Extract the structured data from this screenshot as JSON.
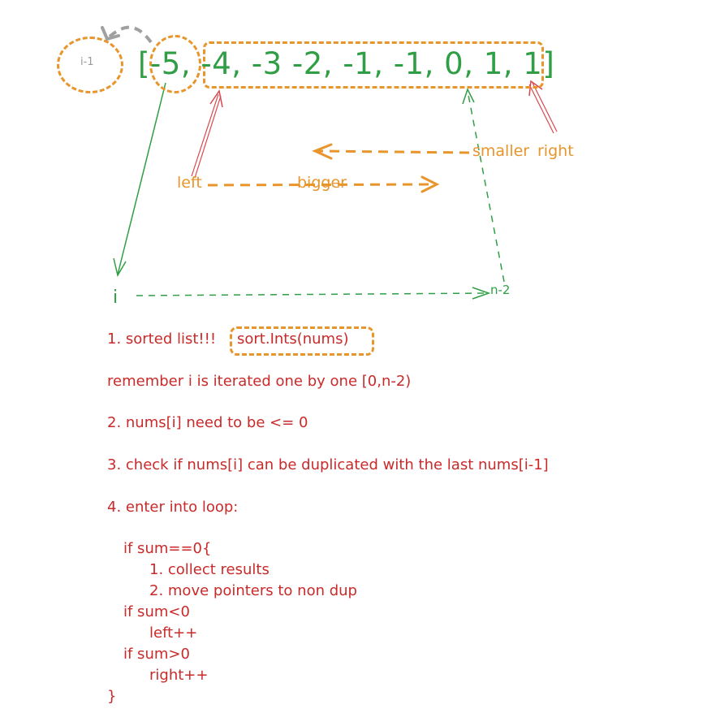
{
  "diagram": {
    "array_text": "[-5, -4, -3 -2, -1, -1, 0, 1, 1]",
    "prev_label": "i-1",
    "i_label": "i",
    "n2_label": "n-2",
    "left_label": "left",
    "bigger_label": "bigger",
    "smaller_label": "smaller",
    "right_label": "right"
  },
  "notes": {
    "line1_prefix": "1. sorted list!!!",
    "line1_code": "sort.Ints(nums)",
    "line2": "remember i is iterated one by one [0,n-2)",
    "line3": "2. nums[i] need to be <= 0",
    "line4": "3. check if nums[i] can be duplicated with the last nums[i-1]",
    "line5": "4. enter into loop:",
    "code": [
      "if sum==0{",
      "1. collect results",
      "2. move pointers to non dup",
      "if sum<0",
      "left++",
      "if sum>0",
      "right++",
      "}"
    ]
  },
  "colors": {
    "orange": "#e8952b",
    "green": "#2f9e44",
    "red": "#c92a2a",
    "gray": "#9a9a9a"
  }
}
